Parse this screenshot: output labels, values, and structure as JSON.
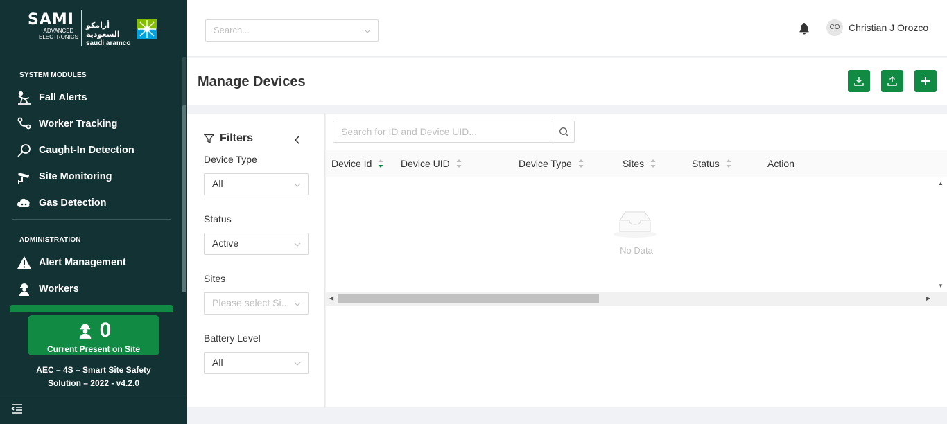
{
  "brand": {
    "sami_word": "SAMI",
    "sami_sub": [
      "ADVANCED",
      "ELECTRONICS"
    ],
    "aramco_ar": "أرامكو السعودية",
    "aramco_en": "saudi aramco"
  },
  "sidebar": {
    "section_system": "SYSTEM MODULES",
    "system_items": [
      {
        "label": "Fall Alerts",
        "icon": "fall-icon"
      },
      {
        "label": "Worker Tracking",
        "icon": "route-icon"
      },
      {
        "label": "Caught-In Detection",
        "icon": "magnifier-icon"
      },
      {
        "label": "Site Monitoring",
        "icon": "cctv-icon"
      },
      {
        "label": "Gas Detection",
        "icon": "gas-cloud-icon"
      }
    ],
    "section_admin": "ADMINISTRATION",
    "admin_items": [
      {
        "label": "Alert Management",
        "icon": "warning-icon"
      },
      {
        "label": "Workers",
        "icon": "worker-icon"
      }
    ],
    "present_count": "0",
    "present_label": "Current Present on Site",
    "footer_line1": "AEC – 4S – Smart Site Safety",
    "footer_line2": "Solution – 2022 - v4.2.0"
  },
  "header": {
    "search_placeholder": "Search...",
    "avatar_initials": "CO",
    "username": "Christian J Orozco"
  },
  "page": {
    "title": "Manage Devices"
  },
  "filters": {
    "title": "Filters",
    "device_type_label": "Device Type",
    "device_type_value": "All",
    "status_label": "Status",
    "status_value": "Active",
    "sites_label": "Sites",
    "sites_placeholder": "Please select Si...",
    "battery_label": "Battery Level",
    "battery_value": "All"
  },
  "table": {
    "search_placeholder": "Search for ID and Device UID...",
    "columns": [
      "Device Id",
      "Device UID",
      "Device Type",
      "Sites",
      "Status",
      "Action"
    ],
    "empty_text": "No Data"
  },
  "colors": {
    "sidebar_bg": "#133234",
    "accent_green": "#118a43"
  }
}
